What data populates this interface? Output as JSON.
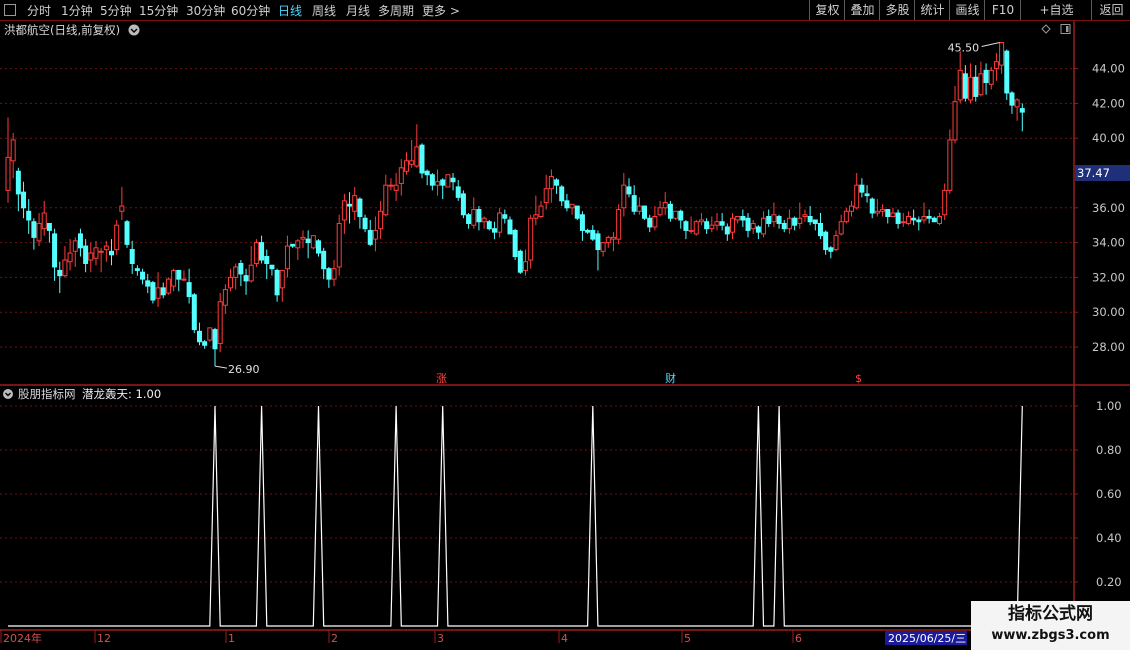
{
  "toolbar": {
    "periods": [
      "分时",
      "1分钟",
      "5分钟",
      "15分钟",
      "30分钟",
      "60分钟",
      "日线",
      "周线",
      "月线",
      "多周期",
      "更多 >"
    ],
    "active_period": "日线",
    "actions": [
      "复权",
      "叠加",
      "多股",
      "统计",
      "画线",
      "F10",
      "+自选",
      "返回"
    ]
  },
  "price_panel": {
    "title": "洪都航空(日线,前复权)",
    "current_price_tag": "37.47"
  },
  "indicator_panel": {
    "title": "股朋指标网",
    "indicator_label": "潜龙轰天: 1.00"
  },
  "event_markers": [
    "涨",
    "财",
    "$"
  ],
  "date_axis": {
    "labels": [
      "2024年",
      "12",
      "1",
      "2",
      "3",
      "4",
      "5",
      "6"
    ],
    "cursor_date": "2025/06/25/三"
  },
  "watermark": {
    "title": "指标公式网",
    "url": "www.zbgs3.com"
  },
  "colors": {
    "up": "#ff3b3b",
    "down": "#54ffff",
    "grid": "#6a1515",
    "signal": "#ffffff",
    "active_tab": "#4fd8ff"
  },
  "chart_data": [
    {
      "type": "candlestick",
      "title": "洪都航空(日线,前复权)",
      "y_ticks": [
        28,
        30,
        32,
        34,
        36,
        40,
        42,
        44
      ],
      "y_tick_labels": [
        "28.00",
        "30.00",
        "32.00",
        "34.00",
        "36.00",
        "40.00",
        "42.00",
        "44.00"
      ],
      "y_range": [
        26.0,
        46.0
      ],
      "annotations": [
        {
          "label": "45.50",
          "value": 45.5,
          "kind": "high"
        },
        {
          "label": "26.90",
          "value": 26.9,
          "kind": "low"
        }
      ],
      "grid": true,
      "candles": [
        [
          37.0,
          38.9,
          36.3,
          41.2
        ],
        [
          38.7,
          39.9,
          37.7,
          40.3
        ],
        [
          38.1,
          36.8,
          35.8,
          38.3
        ],
        [
          36.9,
          36.0,
          35.4,
          37.5
        ],
        [
          35.8,
          35.3,
          34.5,
          36.5
        ],
        [
          35.2,
          34.3,
          33.6,
          35.4
        ],
        [
          34.1,
          35.1,
          33.8,
          35.7
        ],
        [
          34.8,
          35.7,
          34.4,
          36.4
        ],
        [
          35.1,
          34.7,
          34.0,
          35.1
        ],
        [
          34.5,
          32.6,
          31.8,
          34.8
        ],
        [
          32.4,
          32.1,
          31.1,
          32.9
        ],
        [
          32.1,
          33.0,
          32.0,
          33.8
        ],
        [
          32.9,
          33.4,
          32.4,
          34.2
        ],
        [
          33.5,
          34.1,
          32.6,
          34.3
        ],
        [
          34.5,
          33.7,
          33.2,
          34.8
        ],
        [
          33.8,
          32.8,
          32.3,
          34.2
        ],
        [
          33.0,
          33.4,
          32.3,
          34.0
        ],
        [
          33.1,
          33.7,
          32.7,
          34.1
        ],
        [
          33.5,
          33.5,
          32.3,
          33.7
        ],
        [
          33.6,
          33.8,
          32.9,
          34.1
        ],
        [
          33.5,
          33.3,
          32.7,
          34.2
        ],
        [
          33.6,
          35.0,
          33.3,
          35.3
        ],
        [
          35.8,
          36.1,
          35.3,
          37.2
        ],
        [
          35.2,
          33.9,
          33.7,
          35.3
        ],
        [
          33.6,
          32.8,
          32.2,
          34.1
        ],
        [
          32.5,
          32.4,
          32.1,
          32.7
        ],
        [
          32.3,
          31.9,
          31.6,
          32.5
        ],
        [
          31.8,
          31.5,
          31.1,
          32.2
        ],
        [
          31.7,
          30.7,
          30.5,
          31.8
        ],
        [
          30.8,
          31.4,
          30.3,
          32.3
        ],
        [
          31.4,
          31.0,
          30.8,
          31.7
        ],
        [
          31.1,
          31.9,
          31.0,
          32.0
        ],
        [
          31.5,
          32.4,
          31.2,
          32.5
        ],
        [
          32.4,
          31.9,
          31.2,
          32.3
        ],
        [
          31.9,
          31.9,
          31.8,
          32.4
        ],
        [
          31.7,
          30.9,
          30.5,
          32.5
        ],
        [
          31.0,
          29.0,
          28.8,
          31.1
        ],
        [
          28.9,
          28.3,
          28.1,
          29.4
        ],
        [
          28.3,
          28.1,
          27.9,
          28.4
        ],
        [
          28.4,
          29.1,
          28.3,
          29.1
        ],
        [
          29.0,
          27.9,
          26.9,
          29.1
        ],
        [
          28.2,
          30.6,
          27.7,
          31.1
        ],
        [
          30.4,
          31.3,
          29.9,
          31.6
        ],
        [
          31.4,
          32.0,
          31.2,
          32.5
        ],
        [
          32.0,
          32.6,
          31.3,
          32.8
        ],
        [
          32.8,
          32.2,
          31.5,
          33.0
        ],
        [
          32.1,
          31.8,
          31.0,
          32.5
        ],
        [
          31.8,
          32.7,
          31.7,
          33.8
        ],
        [
          32.8,
          34.0,
          32.6,
          34.2
        ],
        [
          34.0,
          33.0,
          32.8,
          34.4
        ],
        [
          33.2,
          32.8,
          31.9,
          33.6
        ],
        [
          32.7,
          32.5,
          32.1,
          32.7
        ],
        [
          32.4,
          31.0,
          30.6,
          32.5
        ],
        [
          31.4,
          32.4,
          30.6,
          32.4
        ],
        [
          32.5,
          33.8,
          32.0,
          34.4
        ],
        [
          33.9,
          33.8,
          33.7,
          33.9
        ],
        [
          33.7,
          34.1,
          33.0,
          34.2
        ],
        [
          34.2,
          34.3,
          33.7,
          34.7
        ],
        [
          34.2,
          34.0,
          33.1,
          34.7
        ],
        [
          33.7,
          34.4,
          33.6,
          34.4
        ],
        [
          34.1,
          33.4,
          33.2,
          34.2
        ],
        [
          33.5,
          32.5,
          31.9,
          33.7
        ],
        [
          32.5,
          31.9,
          31.4,
          32.6
        ],
        [
          31.9,
          32.5,
          31.5,
          33.0
        ],
        [
          32.6,
          35.1,
          32.1,
          35.6
        ],
        [
          35.3,
          36.4,
          34.5,
          36.8
        ],
        [
          36.2,
          36.1,
          35.1,
          36.9
        ],
        [
          35.8,
          36.7,
          35.3,
          37.2
        ],
        [
          36.5,
          35.5,
          34.8,
          36.6
        ],
        [
          35.4,
          34.8,
          34.6,
          35.6
        ],
        [
          34.7,
          33.9,
          33.8,
          35.3
        ],
        [
          34.2,
          34.7,
          33.5,
          35.5
        ],
        [
          34.8,
          35.8,
          34.2,
          36.4
        ],
        [
          35.6,
          37.3,
          35.5,
          37.9
        ],
        [
          37.3,
          37.3,
          37.0,
          37.7
        ],
        [
          37.0,
          37.3,
          36.4,
          38.0
        ],
        [
          37.4,
          38.3,
          36.7,
          38.8
        ],
        [
          38.1,
          38.7,
          37.9,
          39.2
        ],
        [
          38.5,
          38.7,
          38.3,
          39.9
        ],
        [
          38.4,
          39.5,
          38.3,
          40.8
        ],
        [
          39.6,
          38.0,
          37.7,
          39.7
        ],
        [
          38.1,
          37.9,
          37.3,
          38.2
        ],
        [
          37.9,
          37.3,
          37.0,
          38.0
        ],
        [
          37.3,
          37.5,
          36.7,
          38.2
        ],
        [
          37.6,
          37.3,
          36.5,
          37.7
        ],
        [
          37.2,
          37.9,
          37.2,
          37.9
        ],
        [
          37.7,
          37.5,
          37.0,
          38.0
        ],
        [
          37.2,
          36.6,
          36.4,
          37.6
        ],
        [
          36.8,
          35.6,
          35.4,
          37.0
        ],
        [
          35.6,
          35.1,
          34.8,
          35.7
        ],
        [
          35.0,
          35.9,
          34.8,
          36.6
        ],
        [
          35.9,
          35.2,
          34.7,
          36.1
        ],
        [
          35.2,
          35.4,
          34.8,
          35.5
        ],
        [
          35.2,
          34.8,
          34.7,
          35.3
        ],
        [
          34.8,
          34.6,
          34.2,
          35.2
        ],
        [
          34.6,
          35.7,
          34.3,
          36.0
        ],
        [
          35.6,
          35.4,
          35.1,
          35.9
        ],
        [
          35.3,
          34.5,
          34.5,
          35.5
        ],
        [
          34.7,
          33.2,
          33.0,
          34.8
        ],
        [
          33.5,
          32.3,
          32.2,
          33.6
        ],
        [
          32.4,
          32.9,
          32.1,
          33.6
        ],
        [
          33.0,
          35.4,
          32.5,
          35.6
        ],
        [
          35.4,
          35.6,
          35.0,
          36.7
        ],
        [
          35.5,
          36.1,
          35.4,
          36.4
        ],
        [
          36.3,
          37.1,
          35.9,
          37.9
        ],
        [
          37.1,
          37.8,
          36.3,
          38.2
        ],
        [
          37.6,
          37.3,
          36.8,
          37.7
        ],
        [
          37.2,
          36.4,
          36.1,
          37.3
        ],
        [
          36.4,
          36.0,
          35.8,
          36.8
        ],
        [
          36.0,
          36.2,
          35.6,
          36.2
        ],
        [
          36.1,
          35.4,
          35.3,
          36.1
        ],
        [
          35.6,
          34.7,
          34.1,
          35.8
        ],
        [
          34.7,
          34.6,
          34.5,
          34.8
        ],
        [
          34.7,
          34.2,
          34.1,
          35.0
        ],
        [
          34.5,
          33.6,
          32.4,
          34.7
        ],
        [
          33.5,
          34.0,
          33.2,
          34.0
        ],
        [
          34.0,
          34.3,
          33.7,
          34.4
        ],
        [
          34.2,
          34.3,
          33.5,
          34.6
        ],
        [
          34.2,
          35.9,
          33.9,
          36.2
        ],
        [
          36.0,
          37.3,
          35.5,
          38.0
        ],
        [
          37.2,
          36.8,
          36.6,
          37.7
        ],
        [
          36.7,
          35.8,
          35.6,
          37.3
        ],
        [
          35.8,
          36.1,
          35.6,
          36.6
        ],
        [
          36.1,
          35.4,
          35.3,
          36.1
        ],
        [
          35.4,
          34.9,
          34.6,
          35.6
        ],
        [
          34.9,
          35.5,
          34.7,
          36.1
        ],
        [
          35.6,
          36.0,
          35.5,
          36.4
        ],
        [
          36.0,
          36.3,
          35.6,
          36.9
        ],
        [
          36.2,
          35.4,
          35.2,
          36.4
        ],
        [
          35.4,
          35.8,
          35.3,
          35.8
        ],
        [
          35.8,
          35.3,
          34.8,
          35.9
        ],
        [
          35.2,
          34.7,
          34.2,
          35.3
        ],
        [
          34.7,
          34.7,
          34.5,
          35.5
        ],
        [
          34.5,
          35.2,
          34.4,
          35.3
        ],
        [
          35.2,
          35.3,
          35.0,
          35.7
        ],
        [
          35.2,
          34.8,
          34.5,
          35.4
        ],
        [
          34.8,
          35.0,
          34.6,
          35.5
        ],
        [
          35.0,
          35.2,
          34.7,
          35.7
        ],
        [
          35.2,
          35.0,
          34.7,
          35.7
        ],
        [
          34.9,
          34.5,
          34.1,
          35.1
        ],
        [
          34.6,
          35.4,
          34.2,
          35.7
        ],
        [
          35.3,
          35.5,
          35.1,
          35.5
        ],
        [
          35.5,
          35.3,
          34.9,
          35.9
        ],
        [
          35.4,
          34.7,
          34.3,
          35.7
        ],
        [
          34.8,
          35.1,
          34.5,
          35.3
        ],
        [
          34.9,
          34.6,
          34.2,
          35.0
        ],
        [
          34.5,
          35.4,
          34.3,
          35.8
        ],
        [
          35.5,
          35.1,
          34.9,
          35.9
        ],
        [
          35.2,
          35.6,
          34.9,
          36.3
        ],
        [
          35.5,
          35.1,
          34.8,
          35.6
        ],
        [
          35.1,
          34.8,
          34.6,
          35.3
        ],
        [
          34.8,
          35.4,
          34.5,
          35.9
        ],
        [
          35.4,
          35.0,
          34.7,
          35.5
        ],
        [
          35.1,
          35.4,
          34.8,
          36.3
        ],
        [
          35.5,
          35.6,
          35.2,
          35.9
        ],
        [
          35.5,
          35.2,
          35.0,
          36.1
        ],
        [
          35.3,
          35.1,
          34.7,
          35.3
        ],
        [
          35.1,
          34.4,
          34.2,
          35.7
        ],
        [
          34.6,
          33.6,
          33.3,
          34.7
        ],
        [
          33.7,
          33.5,
          33.1,
          33.8
        ],
        [
          33.6,
          34.4,
          33.5,
          34.7
        ],
        [
          34.5,
          35.2,
          34.4,
          35.6
        ],
        [
          35.2,
          35.8,
          35.1,
          36.0
        ],
        [
          35.8,
          36.1,
          35.5,
          36.4
        ],
        [
          36.0,
          37.3,
          35.9,
          38.0
        ],
        [
          37.3,
          36.9,
          36.6,
          37.7
        ],
        [
          36.8,
          36.7,
          36.3,
          37.3
        ],
        [
          36.5,
          35.7,
          35.4,
          36.6
        ],
        [
          35.7,
          35.8,
          35.5,
          36.5
        ],
        [
          35.8,
          35.9,
          35.5,
          36.2
        ],
        [
          35.9,
          35.5,
          35.1,
          35.9
        ],
        [
          35.5,
          35.7,
          35.5,
          36.0
        ],
        [
          35.7,
          35.1,
          34.8,
          35.9
        ],
        [
          35.2,
          35.2,
          34.9,
          35.7
        ],
        [
          35.1,
          35.5,
          35.0,
          35.8
        ],
        [
          35.4,
          35.3,
          35.0,
          35.9
        ],
        [
          35.3,
          35.2,
          34.7,
          35.5
        ],
        [
          35.3,
          35.5,
          35.1,
          36.3
        ],
        [
          35.5,
          35.4,
          35.1,
          35.9
        ],
        [
          35.4,
          35.2,
          35.2,
          35.5
        ],
        [
          35.1,
          35.5,
          35.0,
          35.7
        ],
        [
          35.6,
          37.0,
          35.3,
          37.4
        ],
        [
          37.0,
          39.9,
          36.8,
          40.5
        ],
        [
          39.9,
          42.1,
          39.7,
          43.0
        ],
        [
          42.2,
          43.9,
          42.0,
          45.0
        ],
        [
          43.7,
          42.3,
          42.1,
          44.2
        ],
        [
          42.2,
          43.5,
          42.0,
          44.3
        ],
        [
          43.5,
          42.4,
          42.1,
          44.2
        ],
        [
          42.5,
          43.7,
          42.4,
          44.4
        ],
        [
          43.9,
          43.2,
          42.5,
          44.3
        ],
        [
          43.1,
          43.9,
          42.8,
          44.1
        ],
        [
          44.0,
          44.4,
          43.3,
          44.9
        ],
        [
          44.2,
          45.5,
          43.7,
          45.5
        ],
        [
          45.0,
          42.6,
          42.2,
          45.1
        ],
        [
          42.6,
          41.9,
          41.4,
          42.7
        ],
        [
          41.8,
          42.2,
          41.0,
          42.3
        ],
        [
          41.7,
          41.5,
          40.4,
          42.0
        ]
      ]
    },
    {
      "type": "line",
      "title": "潜龙轰天",
      "y_ticks": [
        0.2,
        0.4,
        0.6,
        0.8,
        1.0
      ],
      "y_tick_labels": [
        "0.20",
        "0.40",
        "0.60",
        "0.80",
        "1.00"
      ],
      "y_range": [
        0,
        1.0
      ],
      "grid": true,
      "signal_indices": [
        40,
        49,
        60,
        75,
        84,
        113,
        145,
        149,
        196,
        197,
        211
      ]
    }
  ]
}
